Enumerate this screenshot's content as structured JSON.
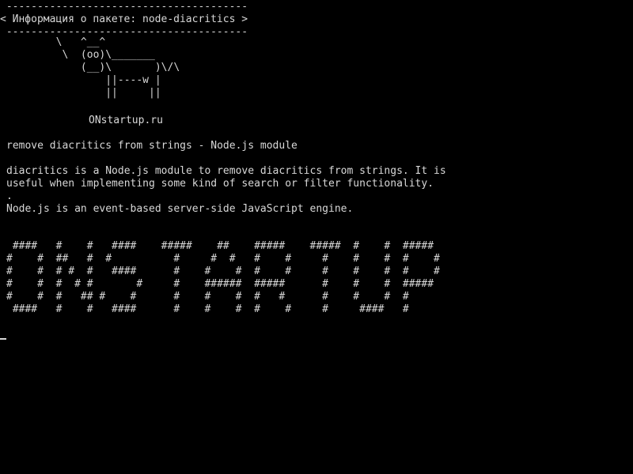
{
  "bubble": {
    "top_border": " ---------------------------------------",
    "title": "< Информация о пакете: node-diacritics >",
    "bottom_border": " ---------------------------------------"
  },
  "cow": {
    "lines": [
      "        \\   ^__^",
      "         \\  (oo)\\_______",
      "            (__)\\       )\\/\\",
      "                ||----w |",
      "                ||     ||"
    ]
  },
  "site": "ONstartup.ru",
  "package": {
    "summary": "remove diacritics from strings - Node.js module",
    "description_lines": [
      "diacritics is a Node.js module to remove diacritics from strings. It is",
      "useful when implementing some kind of search or filter functionality."
    ],
    "separator": ".",
    "engine_note": "Node.js is an event-based server-side JavaScript engine."
  },
  "banner": {
    "lines": [
      " ####   #    #   ####    #####    ##    #####    #####  #    #  #####",
      "#    #  ##   #  #          #     #  #   #    #     #    #    #  #    #",
      "#    #  # #  #   ####      #    #    #  #    #     #    #    #  #    #",
      "#    #  #  # #       #     #    ######  #####      #    #    #  #####",
      "#    #  #   ## #    #      #    #    #  #   #      #    #    #  #",
      " ####   #    #   ####      #    #    #  #    #     #     ####   #"
    ]
  }
}
